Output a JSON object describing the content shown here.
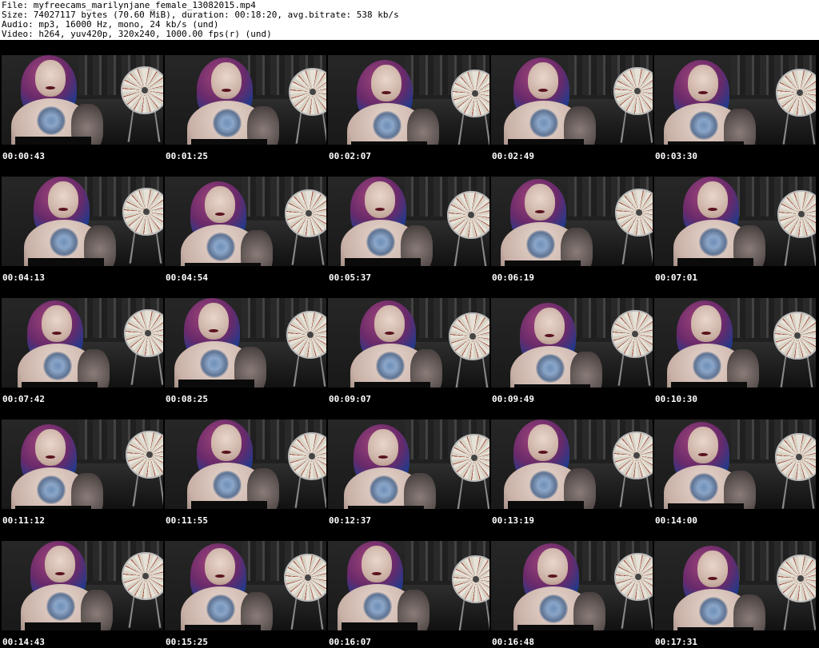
{
  "header": {
    "file_line": "File: myfreecams_marilynjane_female_13082015.mp4",
    "size_line": "Size: 74027117 bytes (70.60 MiB), duration: 00:18:20, avg.bitrate: 538 kb/s",
    "audio_line": "Audio: mp3, 16000 Hz, mono, 24 kb/s (und)",
    "video_line": "Video: h264, yuv420p, 320x240, 1000.00 fps(r) (und)"
  },
  "thumbnails": [
    {
      "timestamp": "00:00:43"
    },
    {
      "timestamp": "00:01:25"
    },
    {
      "timestamp": "00:02:07"
    },
    {
      "timestamp": "00:02:49"
    },
    {
      "timestamp": "00:03:30"
    },
    {
      "timestamp": "00:04:13"
    },
    {
      "timestamp": "00:04:54"
    },
    {
      "timestamp": "00:05:37"
    },
    {
      "timestamp": "00:06:19"
    },
    {
      "timestamp": "00:07:01"
    },
    {
      "timestamp": "00:07:42"
    },
    {
      "timestamp": "00:08:25"
    },
    {
      "timestamp": "00:09:07"
    },
    {
      "timestamp": "00:09:49"
    },
    {
      "timestamp": "00:10:30"
    },
    {
      "timestamp": "00:11:12"
    },
    {
      "timestamp": "00:11:55"
    },
    {
      "timestamp": "00:12:37"
    },
    {
      "timestamp": "00:13:19"
    },
    {
      "timestamp": "00:14:00"
    },
    {
      "timestamp": "00:14:43"
    },
    {
      "timestamp": "00:15:25"
    },
    {
      "timestamp": "00:16:07"
    },
    {
      "timestamp": "00:16:48"
    },
    {
      "timestamp": "00:17:31"
    }
  ],
  "colors": {
    "header_bg": "#ffffff",
    "grid_bg": "#000000",
    "timestamp_text": "#ffffff"
  }
}
